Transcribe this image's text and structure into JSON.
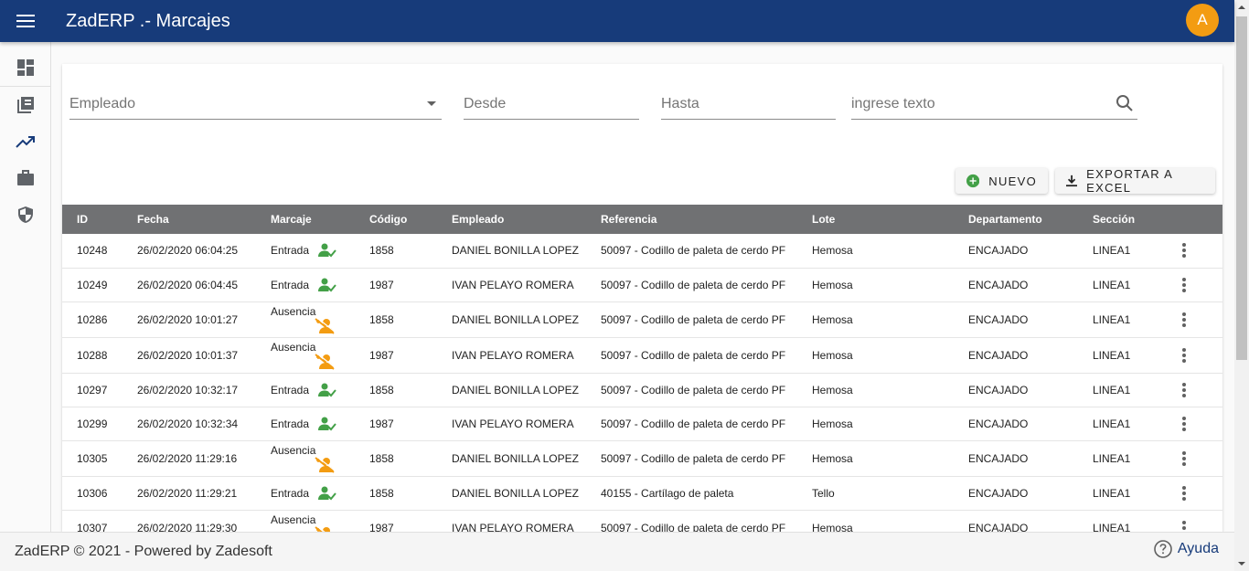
{
  "header": {
    "title": "ZadERP .- Marcajes",
    "avatar_initial": "A"
  },
  "sidebar": {
    "items": [
      {
        "name": "dashboard",
        "icon": "dashboard-icon"
      },
      {
        "name": "library",
        "icon": "library-icon"
      },
      {
        "name": "trending",
        "icon": "trending-up-icon"
      },
      {
        "name": "work",
        "icon": "briefcase-icon"
      },
      {
        "name": "security",
        "icon": "shield-icon"
      }
    ]
  },
  "filters": {
    "empleado_placeholder": "Empleado",
    "desde_placeholder": "Desde",
    "hasta_placeholder": "Hasta",
    "search_placeholder": "ingrese texto"
  },
  "toolbar": {
    "nuevo_label": "NUEVO",
    "exportar_label": "EXPORTAR A EXCEL"
  },
  "table": {
    "columns": [
      "ID",
      "Fecha",
      "Marcaje",
      "Código",
      "Empleado",
      "Referencia",
      "Lote",
      "Departamento",
      "Sección"
    ],
    "rows": [
      [
        "10248",
        "26/02/2020 06:04:25",
        "Entrada",
        "1858",
        "DANIEL BONILLA LOPEZ",
        "50097 - Codillo de paleta de cerdo PF",
        "Hemosa",
        "ENCAJADO",
        "LINEA1"
      ],
      [
        "10249",
        "26/02/2020 06:04:45",
        "Entrada",
        "1987",
        "IVAN PELAYO ROMERA",
        "50097 - Codillo de paleta de cerdo PF",
        "Hemosa",
        "ENCAJADO",
        "LINEA1"
      ],
      [
        "10286",
        "26/02/2020 10:01:27",
        "Ausencia",
        "1858",
        "DANIEL BONILLA LOPEZ",
        "50097 - Codillo de paleta de cerdo PF",
        "Hemosa",
        "ENCAJADO",
        "LINEA1"
      ],
      [
        "10288",
        "26/02/2020 10:01:37",
        "Ausencia",
        "1987",
        "IVAN PELAYO ROMERA",
        "50097 - Codillo de paleta de cerdo PF",
        "Hemosa",
        "ENCAJADO",
        "LINEA1"
      ],
      [
        "10297",
        "26/02/2020 10:32:17",
        "Entrada",
        "1858",
        "DANIEL BONILLA LOPEZ",
        "50097 - Codillo de paleta de cerdo PF",
        "Hemosa",
        "ENCAJADO",
        "LINEA1"
      ],
      [
        "10299",
        "26/02/2020 10:32:34",
        "Entrada",
        "1987",
        "IVAN PELAYO ROMERA",
        "50097 - Codillo de paleta de cerdo PF",
        "Hemosa",
        "ENCAJADO",
        "LINEA1"
      ],
      [
        "10305",
        "26/02/2020 11:29:16",
        "Ausencia",
        "1858",
        "DANIEL BONILLA LOPEZ",
        "50097 - Codillo de paleta de cerdo PF",
        "Hemosa",
        "ENCAJADO",
        "LINEA1"
      ],
      [
        "10306",
        "26/02/2020 11:29:21",
        "Entrada",
        "1858",
        "DANIEL BONILLA LOPEZ",
        "40155 - Cartílago de paleta",
        "Tello",
        "ENCAJADO",
        "LINEA1"
      ],
      [
        "10307",
        "26/02/2020 11:29:30",
        "Ausencia",
        "1987",
        "IVAN PELAYO ROMERA",
        "50097 - Codillo de paleta de cerdo PF",
        "Hemosa",
        "ENCAJADO",
        "LINEA1"
      ]
    ]
  },
  "footer": {
    "copyright": "ZadERP © 2021 - Powered by Zadesoft",
    "help_label": "Ayuda"
  },
  "colors": {
    "header": "#173b7a",
    "avatar": "#f39c12",
    "entrada_icon": "#43a047",
    "ausencia_icon": "#f39c12",
    "table_header": "#707173"
  }
}
